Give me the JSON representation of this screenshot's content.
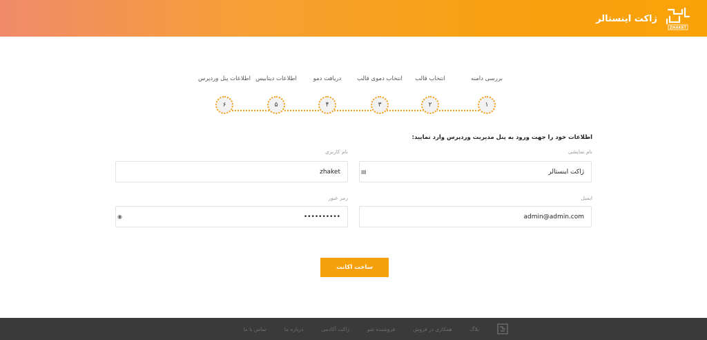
{
  "header": {
    "brand_title": "ژاکت اینستالر",
    "logo_caption": "ZHAKET",
    "colors": {
      "gradient_start": "#f08a6b",
      "gradient_end": "#f9a208"
    }
  },
  "steps": [
    {
      "number": "۱",
      "label": "بررسی دامنه"
    },
    {
      "number": "۲",
      "label": "انتخاب قالب"
    },
    {
      "number": "۳",
      "label": "انتخاب دموی قالب"
    },
    {
      "number": "۴",
      "label": "دریافت دمو"
    },
    {
      "number": "۵",
      "label": "اطلاعات دیتابیس"
    },
    {
      "number": "۶",
      "label": "اطلاعات پنل وردپرس"
    }
  ],
  "form": {
    "intro": "اطلاعات خود را جهت ورود به پنل مدیریت وردپرس وارد نمایید:",
    "display_name": {
      "label": "نام نمایشی",
      "value": "ژاکت اینستالر",
      "icon": "id-card-icon"
    },
    "username": {
      "label": "نام کاربری",
      "value": "zhaket"
    },
    "email": {
      "label": "ایمیل",
      "value": "admin@admin.com"
    },
    "password": {
      "label": "رمز عبور",
      "value": "••••••••••",
      "icon": "eye-icon"
    },
    "submit_label": "ساخت اکانت"
  },
  "footer": {
    "links": [
      "بلاگ",
      "همکاری در فروش",
      "فروشنده شو",
      "ژاکت آکادمی",
      "درباره ما",
      "تماس با ما"
    ],
    "logo_icon": "zhaket-logo-icon"
  },
  "colors": {
    "accent": "#f6a00c",
    "footer_bg": "#3a3a3a"
  }
}
